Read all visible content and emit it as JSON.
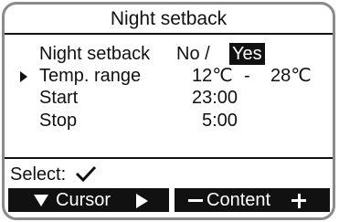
{
  "screen": {
    "title": "Night setback"
  },
  "settings": {
    "night_setback": {
      "label": "Night setback",
      "option_off": "No /",
      "option_on": "Yes",
      "selected": "Yes"
    },
    "temp_range": {
      "label": "Temp. range",
      "min": "12℃",
      "separator": "-",
      "max": "28℃"
    },
    "start": {
      "label": "Start",
      "value": "23:00"
    },
    "stop": {
      "label": "Stop",
      "value": "5:00"
    }
  },
  "footer": {
    "select_label": "Select:",
    "select_icon": "checkmark-icon"
  },
  "softkeys": {
    "cursor_label": "Cursor",
    "content_label": "Content",
    "cursor_left_icon": "triangle-down-icon",
    "cursor_right_icon": "triangle-right-icon",
    "content_left_icon": "minus-icon",
    "content_right_icon": "plus-icon"
  }
}
